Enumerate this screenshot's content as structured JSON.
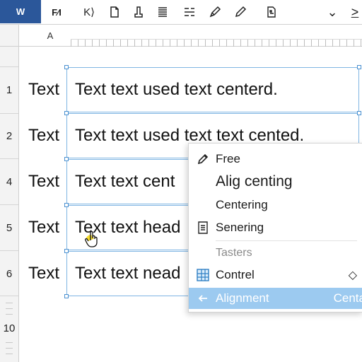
{
  "app": {
    "badge": "W"
  },
  "toolbar": {
    "buttons": [
      {
        "name": "format-painter-icon",
        "text": "F⁄I"
      },
      {
        "name": "undo-icon",
        "text": "K⟩"
      }
    ],
    "more_label": "⌄",
    "next_label": ">"
  },
  "columns": {
    "a_label": "A"
  },
  "rows": [
    {
      "num": "1",
      "label": "Text",
      "content": "Text text used text centerd."
    },
    {
      "num": "2",
      "label": "Text",
      "content": "Text text used text text cented."
    },
    {
      "num": "4",
      "label": "Text",
      "content": "Text text cent"
    },
    {
      "num": "5",
      "label": "Text",
      "content": "Text text head"
    },
    {
      "num": "6",
      "label": "Text",
      "content": "Text text nead"
    }
  ],
  "row_gutter_extra": {
    "num": "10"
  },
  "context_menu": {
    "items": [
      {
        "label": "Free",
        "icon": "pencil-icon"
      },
      {
        "label": "Alig centing",
        "icon": ""
      },
      {
        "label": "Centering",
        "icon": ""
      },
      {
        "label": "Senering",
        "icon": "document-icon"
      },
      {
        "label": "Tasters",
        "icon": "",
        "muted": true
      },
      {
        "label": "Contrel",
        "icon": "table-icon",
        "right": "◇"
      },
      {
        "label": "Alignment",
        "icon": "arrow-left-icon",
        "right": "Centa",
        "active": true
      }
    ]
  },
  "colors": {
    "brand": "#2b579a",
    "selection": "#9ccaf0",
    "cell_border": "#7fb5e3"
  }
}
